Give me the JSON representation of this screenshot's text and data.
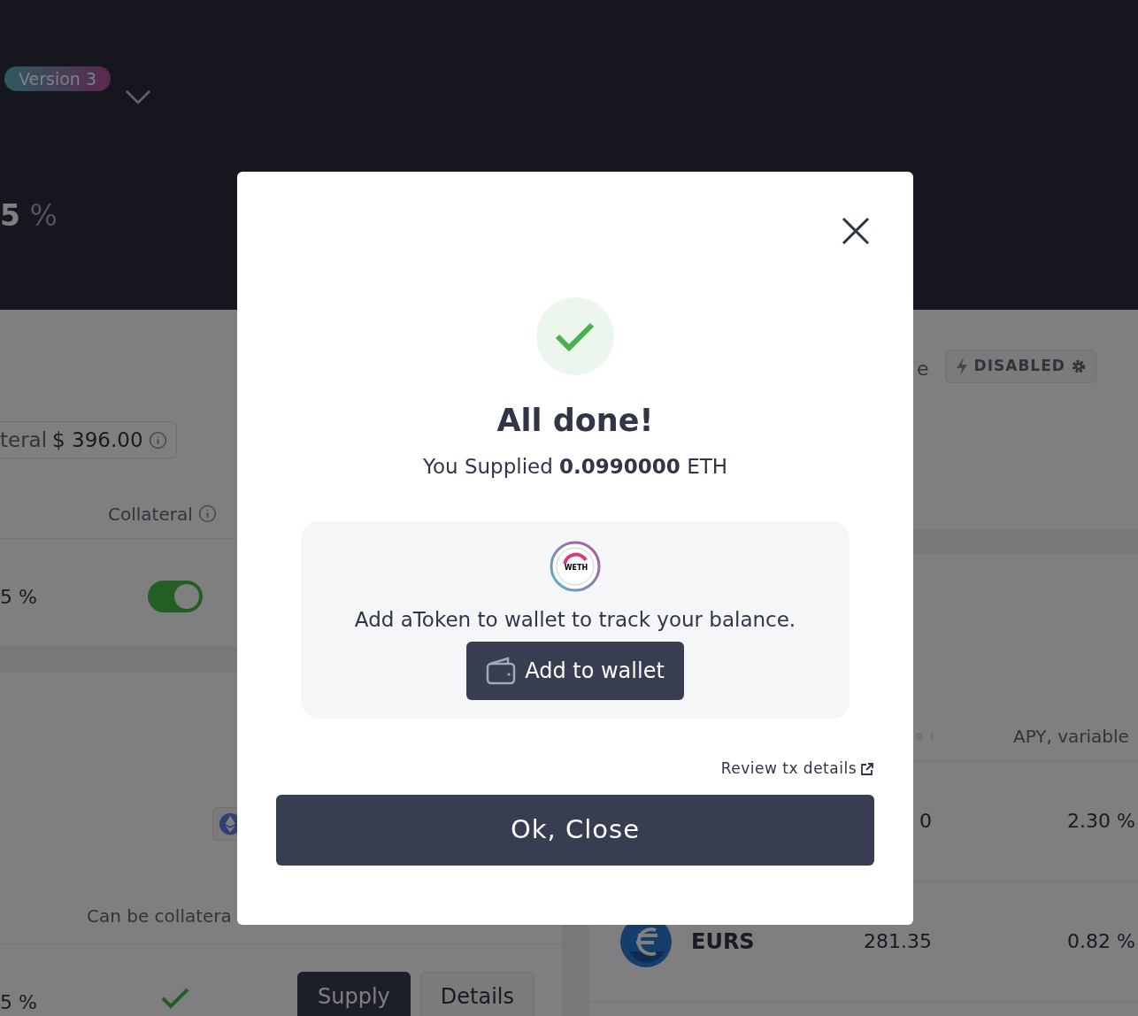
{
  "header": {
    "version_badge": "Version 3",
    "stat": "5",
    "stat_unit": "%"
  },
  "supplies_card": {
    "collateral_chip": {
      "label": "teral",
      "value": "$ 396.00"
    },
    "column": "Collateral",
    "rows": [
      {
        "apy": "5 %",
        "collateral": true
      }
    ]
  },
  "mode": {
    "label_tail": "e",
    "badge": "DISABLED"
  },
  "assets_card": {
    "footer_label": "Can be collatera",
    "rows": [
      {
        "apy": "5 %",
        "can_be_collateral": true,
        "buttons": [
          "Supply",
          "Details"
        ]
      }
    ]
  },
  "borrow_card": {
    "column": "APY, variable",
    "rows": [
      {
        "balance": "0",
        "apy": "2.30 %"
      },
      {
        "symbol": "EURS",
        "balance": "281.35",
        "apy": "0.82 %"
      }
    ]
  },
  "modal": {
    "title": "All done!",
    "message": "You Supplied **0.0990000** ETH",
    "token_symbol": "WETH",
    "hint": "Add aToken to wallet to track your balance.",
    "add_button": "Add to wallet",
    "review_link": "Review tx details",
    "ok_button": "Ok, Close"
  }
}
